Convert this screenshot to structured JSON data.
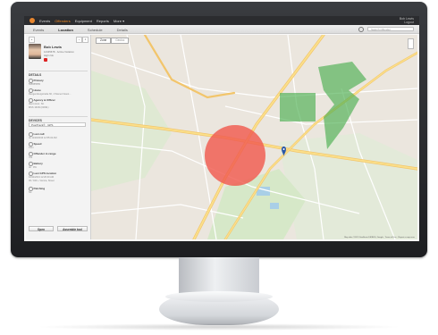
{
  "nav": {
    "items": [
      "Events",
      "Offenders",
      "Equipment",
      "Reports",
      "More ▾"
    ],
    "active_index": 1,
    "user": [
      "Bob Lewis",
      "Logout"
    ]
  },
  "subnav": {
    "tabs": [
      "Events",
      "Location",
      "Schedule",
      "Details"
    ],
    "active_index": 1,
    "search_placeholder": "Search Offender"
  },
  "profile": {
    "name": "Bob Lewis",
    "id_line": "12345678 · Active Violation",
    "sub_line": "High risk"
  },
  "details": {
    "title": "DETAILS",
    "rows": [
      {
        "label": "Primary",
        "value": "555555555"
      },
      {
        "label": "Home",
        "value": "Rengersbergstraße 60, 1 Wiener Neust..."
      },
      {
        "label": "Agency & Officer",
        "value": "Ident-Graz, SC"
      }
    ],
    "extra_value": "MSS 16/09 (00091)"
  },
  "devices": {
    "title": "DEVICES",
    "selected": "PosiTrack® · GPS",
    "rows": [
      {
        "label": "Last call",
        "value": "ok 11/20/2013 12:55:34 AM"
      },
      {
        "label": "Speed",
        "value": "0 km"
      },
      {
        "label": "Offender in range",
        "value": "Yes"
      },
      {
        "label": "Battery",
        "value": "ok · 9%"
      },
      {
        "label": "Last GPS location",
        "value": "10/11/2013 12:26:40 AM"
      },
      {
        "label": "Patching",
        "value": "No"
      }
    ],
    "gps_extra": "00 / 040 + Vienna, Street"
  },
  "footer": {
    "left_button": "Open",
    "right_button": "Assemble tool"
  },
  "map": {
    "type_buttons": [
      "Zone",
      "Geoloc"
    ],
    "active_type": 0,
    "attribution": "Map data ©2013 GeoBasis-DE/BKG, Google · Terms of Use · Report a map error",
    "zone_colors": {
      "exclusion": "#f05a4f",
      "inclusion": "#4caf50"
    }
  },
  "colors": {
    "accent": "#f08a24",
    "topbar": "#2b2c2f"
  }
}
